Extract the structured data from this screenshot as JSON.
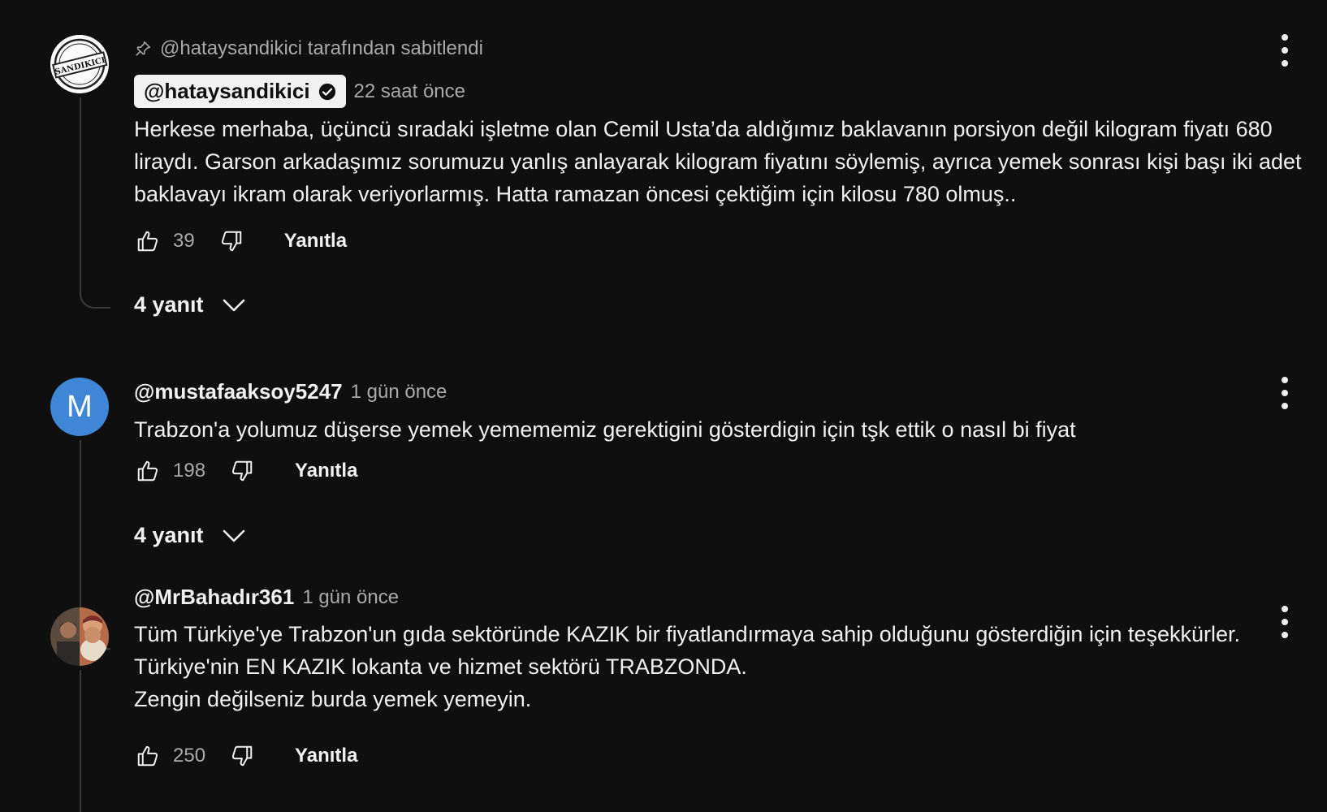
{
  "comments": [
    {
      "pinned_text": "@hataysandikici tarafından sabitlendi",
      "author": "@hataysandikici",
      "time": "22 saat önce",
      "text": "Herkese merhaba, üçüncü sıradaki işletme olan Cemil Usta’da aldığımız baklavanın porsiyon değil kilogram fiyatı 680 liraydı. Garson arkadaşımız sorumuzu yanlış anlayarak kilogram fiyatını söylemiş, ayrıca yemek sonrası kişi başı iki adet baklavayı ikram olarak veriyorlarmış. Hatta ramazan öncesi çektiğim için kilosu 780 olmuş..",
      "likes": "39",
      "reply_label": "Yanıtla",
      "replies_label": "4 yanıt",
      "avatar_text": "SANDIKICI"
    },
    {
      "author": "@mustafaaksoy5247",
      "time": "1 gün önce",
      "text": "Trabzon'a yolumuz düşerse yemek yemememiz gerektigini gösterdigin için tşk ettik o nasıl bi fiyat",
      "likes": "198",
      "reply_label": "Yanıtla",
      "replies_label": "4 yanıt",
      "avatar_letter": "M"
    },
    {
      "author": "@MrBahadır361",
      "time": "1 gün önce",
      "text": "Tüm Türkiye'ye Trabzon'un gıda sektöründe KAZIK bir fiyatlandırmaya sahip olduğunu gösterdiğin için teşekkürler.\nTürkiye'nin EN KAZIK lokanta ve hizmet sektörü TRABZONDA.\nZengin değilseniz burda yemek yemeyin.",
      "likes": "250",
      "reply_label": "Yanıtla"
    }
  ]
}
